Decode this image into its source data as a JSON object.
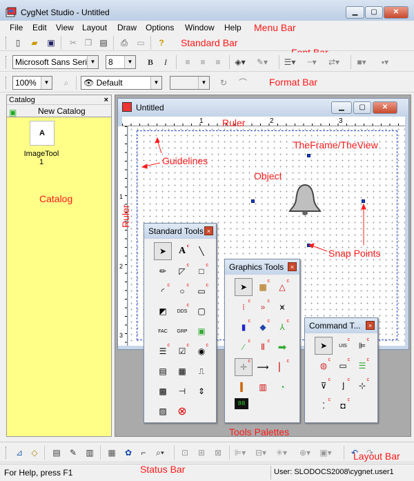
{
  "window": {
    "title": "CygNet Studio - Untitled"
  },
  "menu": [
    "File",
    "Edit",
    "View",
    "Layout",
    "Draw",
    "Options",
    "Window",
    "Help"
  ],
  "font_bar": {
    "font": "Microsoft Sans Serif",
    "size": "8",
    "bold": "B",
    "italic": "I"
  },
  "format_bar": {
    "zoom": "100%",
    "view": "Default"
  },
  "catalog": {
    "title": "Catalog",
    "close": "×",
    "new": "New Catalog",
    "item_name": "ImageTool",
    "item_count": "1"
  },
  "doc": {
    "title": "Untitled",
    "ruler_ticks": [
      "1",
      "2",
      "3"
    ],
    "vruler_ticks": [
      "1",
      "2",
      "3"
    ]
  },
  "palettes": {
    "standard": {
      "title": "Standard Tools"
    },
    "graphics": {
      "title": "Graphics Tools"
    },
    "command": {
      "title": "Command T..."
    }
  },
  "status": {
    "help": "For Help, press F1",
    "user": "User: SLODOCS2008\\cygnet.user1"
  },
  "annotations": {
    "menu_bar": "Menu Bar",
    "standard_bar": "Standard Bar",
    "font_bar": "Font Bar",
    "format_bar": "Format Bar",
    "ruler_top": "Ruler",
    "frame_view": "TheFrame/TheView",
    "guidelines": "Guidelines",
    "object": "Object",
    "catalog": "Catalog",
    "ruler_left": "Ruler",
    "snap_points": "Snap Points",
    "tools_palettes": "Tools Palettes",
    "status_bar": "Status Bar",
    "layout_bar": "Layout Bar"
  },
  "colors": {
    "annotation": "#ff1a1a",
    "catalog_bg": "#ffff88",
    "snap": "#1040c0"
  }
}
